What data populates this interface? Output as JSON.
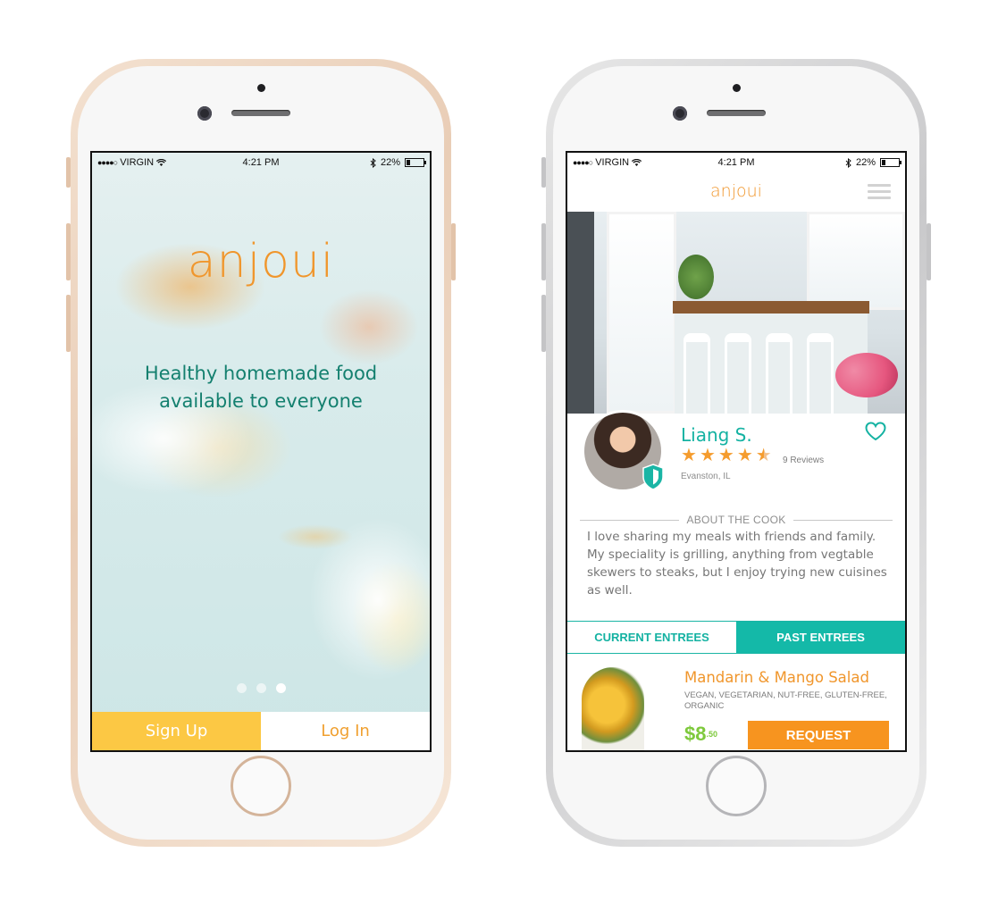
{
  "phones": {
    "left": {
      "status": {
        "carrier": "VIRGIN",
        "time": "4:21 PM",
        "battery": "22%",
        "battery_level": 0.22
      },
      "logo": "anjoui",
      "tagline_line1": "Healthy homemade food",
      "tagline_line2": "available to everyone",
      "pager": {
        "count": 3,
        "active_index": 2
      },
      "signup_label": "Sign Up",
      "login_label": "Log In",
      "colors": {
        "accent": "#f0962c",
        "teal": "#14806f",
        "signup_bg": "#fcc844"
      }
    },
    "right": {
      "status": {
        "carrier": "VIRGIN",
        "time": "4:21 PM",
        "battery": "22%",
        "battery_level": 0.22
      },
      "header": {
        "logo": "anjoui",
        "menu_icon": "hamburger-menu-icon"
      },
      "cook": {
        "name": "Liang S.",
        "rating": 4.5,
        "reviews": "9 Reviews",
        "location": "Evanston, IL",
        "favorite_icon": "heart-icon",
        "badge_icon": "shield-icon"
      },
      "about_heading": "ABOUT THE COOK",
      "about_text": "I love sharing my meals with friends and family. My speciality is grilling, anything from vegtable skewers to steaks, but I enjoy trying new cuisines as well.",
      "tabs": [
        {
          "label": "CURRENT ENTREES",
          "active": false
        },
        {
          "label": "PAST ENTREES",
          "active": true
        }
      ],
      "entree": {
        "title": "Mandarin & Mango Salad",
        "tags": "VEGAN, VEGETARIAN, NUT-FREE, GLUTEN-FREE, ORGANIC",
        "price_dollars": "$8",
        "price_cents": ".50",
        "request_label": "REQUEST"
      },
      "colors": {
        "teal": "#14b2a2",
        "orange": "#f7941f",
        "price_green": "#7ec93c",
        "star": "#f59c2e"
      }
    }
  }
}
